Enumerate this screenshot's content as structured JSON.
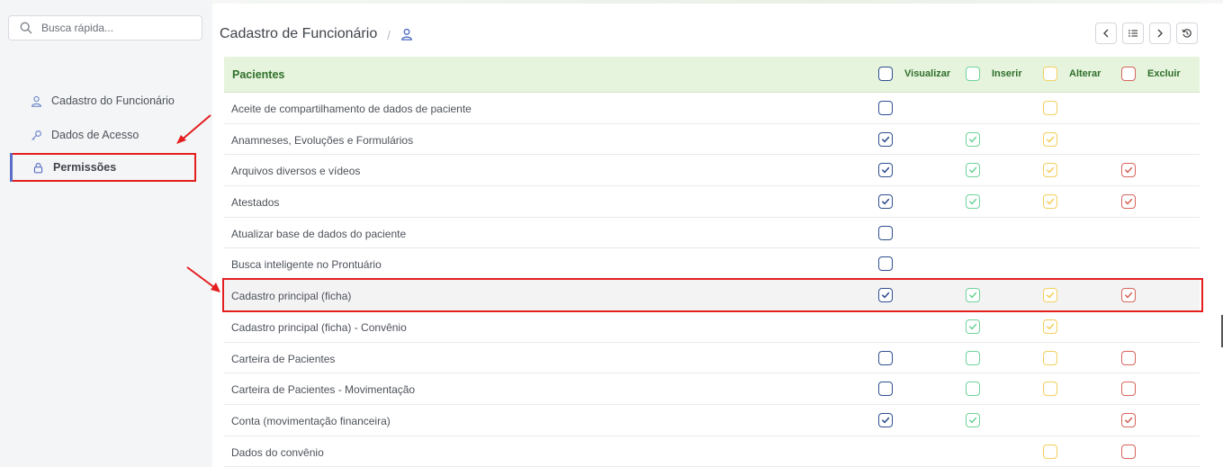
{
  "search": {
    "placeholder": "Busca rápida..."
  },
  "sidebar": {
    "items": [
      {
        "label": "Cadastro do Funcionário",
        "icon": "user-icon"
      },
      {
        "label": "Dados de Acesso",
        "icon": "key-icon"
      },
      {
        "label": "Permissões",
        "icon": "lock-icon",
        "active": true
      }
    ]
  },
  "header": {
    "title": "Cadastro de Funcionário",
    "separator": "/"
  },
  "table": {
    "group": "Pacientes",
    "columns": [
      "Visualizar",
      "Inserir",
      "Alterar",
      "Excluir"
    ],
    "column_colors": [
      "#2f4f8f",
      "#6fd39a",
      "#f3cf5c",
      "#d6645c"
    ],
    "rows": [
      {
        "label": "Aceite de compartilhamento de dados de paciente",
        "cells": [
          "unchecked",
          null,
          "unchecked",
          null
        ]
      },
      {
        "label": "Anamneses, Evoluções e Formulários",
        "cells": [
          "checked",
          "checked",
          "checked",
          null
        ]
      },
      {
        "label": "Arquivos diversos e vídeos",
        "cells": [
          "checked",
          "checked",
          "checked",
          "checked"
        ]
      },
      {
        "label": "Atestados",
        "cells": [
          "checked",
          "checked",
          "checked",
          "checked"
        ]
      },
      {
        "label": "Atualizar base de dados do paciente",
        "cells": [
          "unchecked",
          null,
          null,
          null
        ]
      },
      {
        "label": "Busca inteligente no Prontuário",
        "cells": [
          "unchecked",
          null,
          null,
          null
        ]
      },
      {
        "label": "Cadastro principal (ficha)",
        "cells": [
          "checked",
          "checked",
          "checked",
          "checked"
        ],
        "highlight": true
      },
      {
        "label": "Cadastro principal (ficha) - Convênio",
        "cells": [
          null,
          "checked",
          "checked",
          null
        ]
      },
      {
        "label": "Carteira de Pacientes",
        "cells": [
          "unchecked",
          "unchecked",
          "unchecked",
          "unchecked"
        ]
      },
      {
        "label": "Carteira de Pacientes - Movimentação",
        "cells": [
          "unchecked",
          "unchecked",
          "unchecked",
          "unchecked"
        ]
      },
      {
        "label": "Conta (movimentação financeira)",
        "cells": [
          "checked",
          "checked",
          null,
          "checked"
        ]
      },
      {
        "label": "Dados do convênio",
        "cells": [
          null,
          null,
          "unchecked",
          "unchecked"
        ]
      }
    ]
  }
}
